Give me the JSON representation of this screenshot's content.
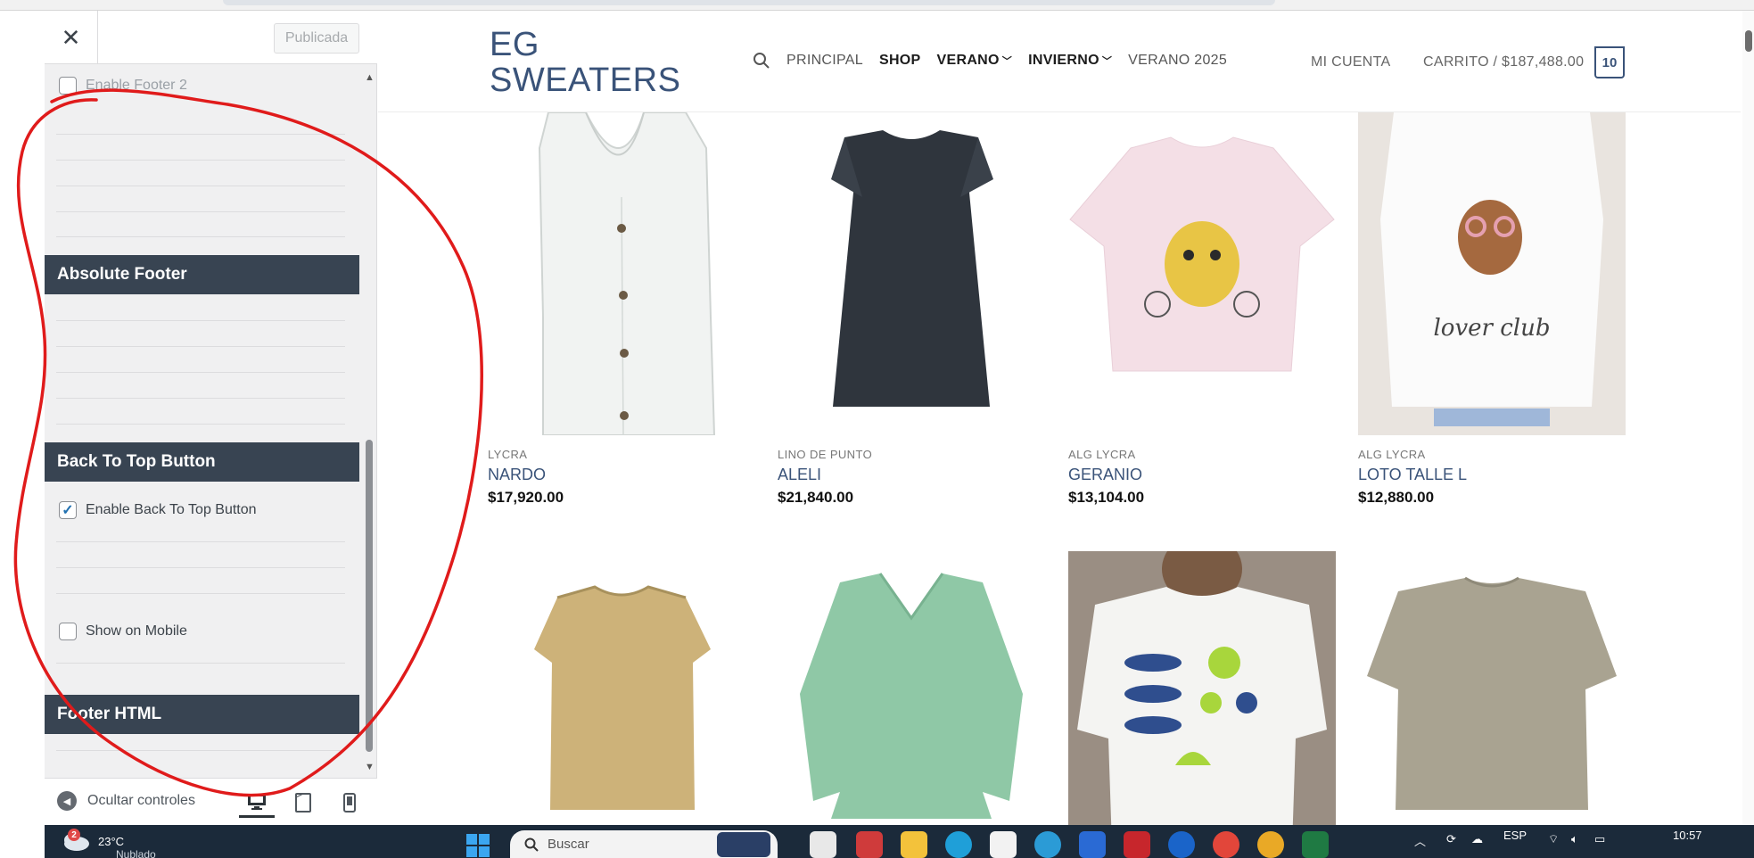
{
  "customizer": {
    "close_label": "✕",
    "publish_label": "Publicada",
    "enable_footer2_label": "Enable Footer 2",
    "sections": {
      "absolute_footer": "Absolute Footer",
      "back_to_top": "Back To Top Button",
      "footer_html": "Footer HTML"
    },
    "options": {
      "enable_back_to_top": {
        "label": "Enable Back To Top Button",
        "checked": true
      },
      "show_on_mobile": {
        "label": "Show on Mobile",
        "checked": false
      }
    },
    "footer": {
      "hide_controls_label": "Ocultar controles",
      "devices": [
        "desktop-icon",
        "tablet-icon",
        "mobile-icon"
      ]
    }
  },
  "site": {
    "logo_line1": "EG",
    "logo_line2": "SWEATERS",
    "nav": [
      {
        "label": "PRINCIPAL"
      },
      {
        "label": "SHOP",
        "active": true
      },
      {
        "label": "VERANO",
        "dropdown": true
      },
      {
        "label": "INVIERNO",
        "dropdown": true
      },
      {
        "label": "VERANO 2025"
      }
    ],
    "account_label": "MI CUENTA",
    "cart_label": "CARRITO / $187,488.00",
    "cart_count": "10",
    "products": [
      {
        "category": "LYCRA",
        "name": "NARDO",
        "price": "$17,920.00"
      },
      {
        "category": "LINO DE PUNTO",
        "name": "ALELI",
        "price": "$21,840.00"
      },
      {
        "category": "ALG LYCRA",
        "name": "GERANIO",
        "price": "$13,104.00"
      },
      {
        "category": "ALG LYCRA",
        "name": "LOTO TALLE L",
        "price": "$12,880.00"
      },
      {
        "category": "",
        "name": "",
        "price": ""
      },
      {
        "category": "",
        "name": "",
        "price": ""
      },
      {
        "category": "",
        "name": "",
        "price": ""
      },
      {
        "category": "",
        "name": "",
        "price": ""
      }
    ],
    "product_print_text": "lover club"
  },
  "taskbar": {
    "weather_badge": "2",
    "temperature": "23°C",
    "condition": "Nublado",
    "search_placeholder": "Buscar",
    "language": "ESP",
    "time": "10:57"
  },
  "colors": {
    "section_header": "#384452",
    "brand_blue": "#3a5379",
    "annotation": "#e01b1b",
    "whatsapp": "#4cd964",
    "taskbar": "#1b2a3a"
  }
}
